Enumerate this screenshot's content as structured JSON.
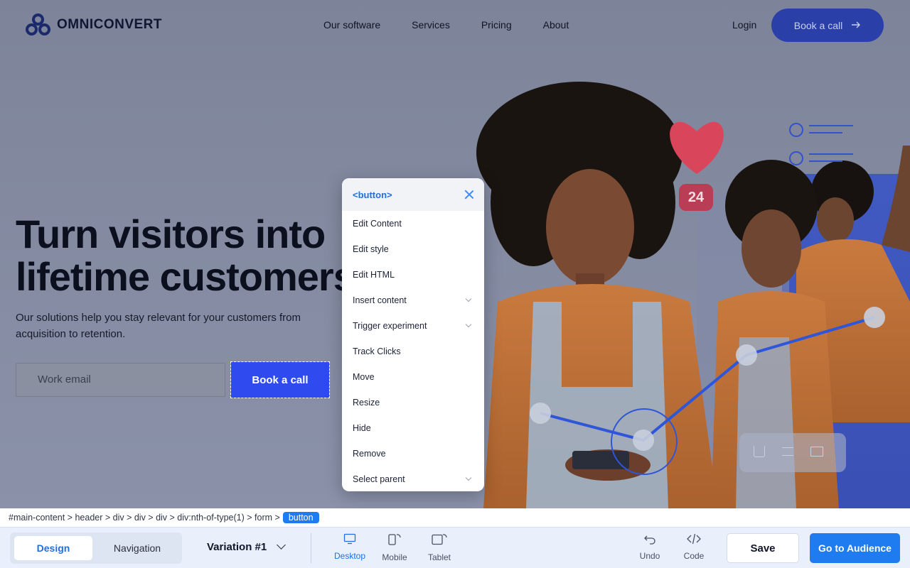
{
  "site": {
    "brand": "OMNICONVERT",
    "nav": [
      "Our software",
      "Services",
      "Pricing",
      "About"
    ],
    "login": "Login",
    "nav_cta": "Book a call",
    "hero_title_line1": "Turn visitors into",
    "hero_title_line2": "lifetime customers",
    "hero_sub": "Our solutions help you stay relevant for your customers from acquisition to retention.",
    "email_placeholder": "Work email",
    "hero_cta": "Book a call",
    "badge_count": "24"
  },
  "context_menu": {
    "tag": "<button>",
    "items": [
      {
        "label": "Edit Content",
        "submenu": false
      },
      {
        "label": "Edit style",
        "submenu": false
      },
      {
        "label": "Edit HTML",
        "submenu": false
      },
      {
        "label": "Insert content",
        "submenu": true
      },
      {
        "label": "Trigger experiment",
        "submenu": true
      },
      {
        "label": "Track Clicks",
        "submenu": false
      },
      {
        "label": "Move",
        "submenu": false
      },
      {
        "label": "Resize",
        "submenu": false
      },
      {
        "label": "Hide",
        "submenu": false
      },
      {
        "label": "Remove",
        "submenu": false
      },
      {
        "label": "Select parent",
        "submenu": true
      }
    ]
  },
  "breadcrumb": {
    "path": "#main-content > header > div > div > div > div:nth-of-type(1) > form >",
    "current": "button"
  },
  "toolbar": {
    "tab_design": "Design",
    "tab_navigation": "Navigation",
    "variation": "Variation #1",
    "devices": [
      "Desktop",
      "Mobile",
      "Tablet"
    ],
    "undo": "Undo",
    "code": "Code",
    "save": "Save",
    "go_to_audience": "Go to Audience"
  },
  "colors": {
    "accent": "#1f7cf0",
    "hero_button": "#2f4bf0",
    "nav_cta": "#2b3fa8"
  }
}
